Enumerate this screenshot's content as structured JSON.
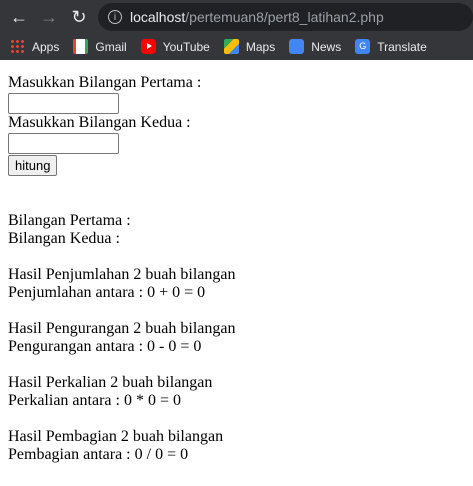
{
  "browser": {
    "url_host": "localhost",
    "url_path": "/pertemuan8/pert8_latihan2.php",
    "bookmarks": [
      {
        "label": "Apps",
        "icon": "apps-grid-icon"
      },
      {
        "label": "Gmail",
        "icon": "gmail-icon"
      },
      {
        "label": "YouTube",
        "icon": "youtube-icon"
      },
      {
        "label": "Maps",
        "icon": "maps-icon"
      },
      {
        "label": "News",
        "icon": "news-icon"
      },
      {
        "label": "Translate",
        "icon": "translate-icon"
      }
    ]
  },
  "form": {
    "label_first": "Masukkan Bilangan Pertama :",
    "label_second": "Masukkan Bilangan Kedua :",
    "first_value": "",
    "second_value": "",
    "submit_label": "hitung"
  },
  "results": {
    "first": "Bilangan Pertama :",
    "second": "Bilangan Kedua :",
    "add_title": "Hasil Penjumlahan 2 buah bilangan",
    "add_line": "Penjumlahan antara : 0 + 0 = 0",
    "sub_title": "Hasil Pengurangan 2 buah bilangan",
    "sub_line": "Pengurangan antara : 0 - 0 = 0",
    "mul_title": "Hasil Perkalian 2 buah bilangan",
    "mul_line": "Perkalian antara : 0 * 0 = 0",
    "div_title": "Hasil Pembagian 2 buah bilangan",
    "div_line": "Pembagian antara : 0 / 0 = 0"
  }
}
